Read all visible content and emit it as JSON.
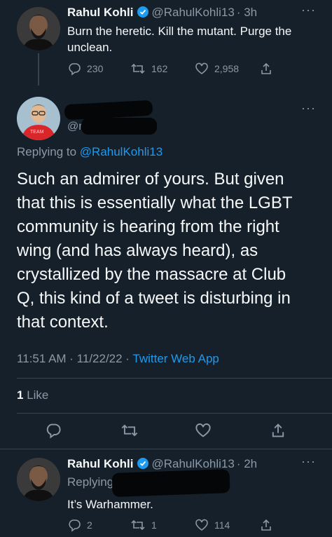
{
  "tweet1": {
    "name": "Rahul Kohli",
    "handle": "@RahulKohli13",
    "time": "· 3h",
    "text_line1": "Burn the heretic. Kill the mutant. Purge the",
    "text_line2": "unclean.",
    "replies": "230",
    "retweets": "162",
    "likes": "2,958"
  },
  "main": {
    "handle": "@r",
    "replying_prefix": "Replying to ",
    "replying_handle": "@RahulKohli13",
    "lines": [
      "Such an admirer of yours. But given",
      "that this is essentially what the LGBT",
      "community is hearing from the right",
      "wing (and has always heard), as",
      "crystallized by the massacre at Club",
      "Q, this kind of a tweet is disturbing in",
      "that context."
    ],
    "timestamp": "11:51 AM · 11/22/22 · ",
    "source": "Twitter Web App",
    "like_count": "1",
    "like_label": " Like",
    "shirt_text": "TEAM"
  },
  "tweet2": {
    "name": "Rahul Kohli",
    "handle": "@RahulKohli13",
    "time": "· 2h",
    "replying": "Replying to @r",
    "text": "It’s Warhammer.",
    "replies": "2",
    "retweets": "1",
    "likes": "114"
  },
  "more_label": "···",
  "colors": {
    "background": "#15202b",
    "accent": "#1d9bf0",
    "muted": "#8b98a5",
    "divider": "#38444d"
  }
}
